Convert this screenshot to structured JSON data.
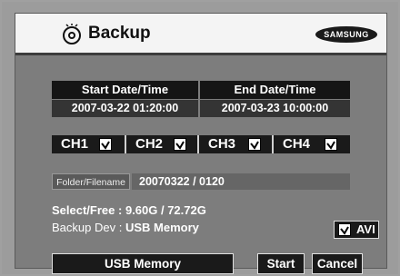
{
  "header": {
    "title": "Backup",
    "brand": "SAMSUNG"
  },
  "datetime": {
    "start_label": "Start Date/Time",
    "end_label": "End Date/Time",
    "start_value": "2007-03-22 01:20:00",
    "end_value": "2007-03-23 10:00:00"
  },
  "channels": [
    {
      "label": "CH1",
      "checked": true
    },
    {
      "label": "CH2",
      "checked": true
    },
    {
      "label": "CH3",
      "checked": true
    },
    {
      "label": "CH4",
      "checked": true
    }
  ],
  "folder": {
    "label": "Folder/Filename",
    "value": "20070322 / 0120"
  },
  "info": {
    "select_free_label": "Select/Free :",
    "select_free_value": "9.60G / 72.72G",
    "backup_dev_label": "Backup Dev :",
    "backup_dev_value": "USB Memory"
  },
  "avi": {
    "label": "AVI",
    "checked": true
  },
  "buttons": {
    "device": "USB Memory",
    "start": "Start",
    "cancel": "Cancel"
  }
}
